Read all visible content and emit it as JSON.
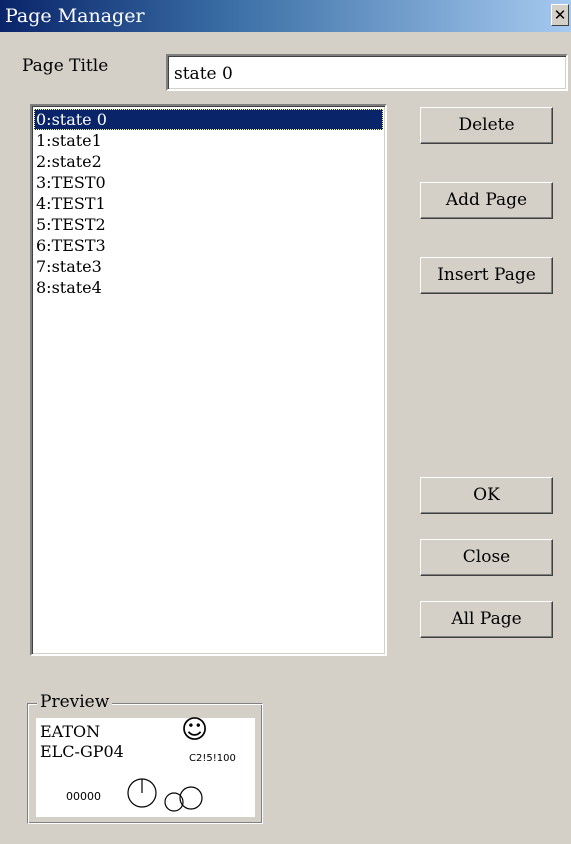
{
  "window": {
    "title": "Page Manager",
    "close_glyph": "✕"
  },
  "page_title": {
    "label": "Page Title",
    "value": "state 0"
  },
  "pages": [
    "0:state 0",
    "1:state1",
    "2:state2",
    "3:TEST0",
    "4:TEST1",
    "5:TEST2",
    "6:TEST3",
    "7:state3",
    "8:state4"
  ],
  "selected_page_index": 0,
  "buttons": {
    "delete": "Delete",
    "add_page": "Add Page",
    "insert_page": "Insert Page",
    "ok": "OK",
    "close": "Close",
    "all_page": "All Page"
  },
  "preview": {
    "label": "Preview",
    "brand": "EATON",
    "model": "ELC-GP04",
    "smiley_glyph": "☺",
    "small_text": "C2!5!100",
    "counter": "00000"
  },
  "colors": {
    "dialog_bg": "#d4d0c8",
    "title_bar_start": "#0a246a",
    "title_bar_end": "#a6caf0",
    "selection": "#0a246a"
  }
}
